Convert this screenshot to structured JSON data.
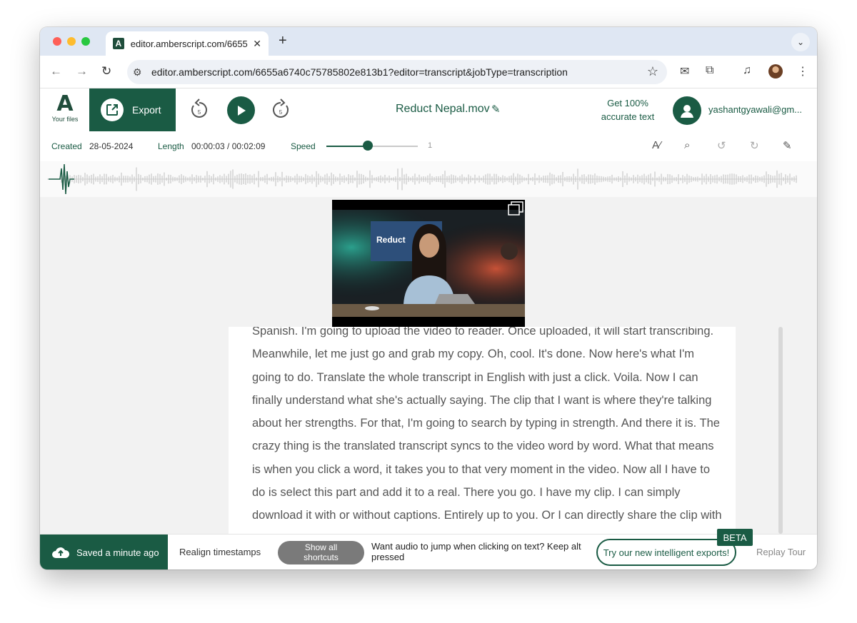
{
  "browser": {
    "tab_title": "editor.amberscript.com/6655",
    "url": "editor.amberscript.com/6655a6740c75785802e813b1?editor=transcript&jobType=transcription"
  },
  "header": {
    "logo_letter": "A",
    "logo_label": "Your files",
    "export_label": "Export",
    "skip_back_label": "5",
    "skip_forward_label": "5",
    "file_name": "Reduct Nepal.mov",
    "accurate_text_line1": "Get 100%",
    "accurate_text_line2": "accurate text",
    "user_email": "yashantgyawali@gm..."
  },
  "info": {
    "created_label": "Created",
    "created_value": "28-05-2024",
    "length_label": "Length",
    "length_value": "00:00:03 / 00:02:09",
    "speed_label": "Speed",
    "speed_value": "1",
    "speed_fraction": 0.45
  },
  "transcript": {
    "text": "Spanish. I'm going to upload the video to reader. Once uploaded, it will start transcribing. Meanwhile, let me just go and grab my copy. Oh, cool. It's done. Now here's what I'm going to do. Translate the whole transcript in English with just a click. Voila. Now I can finally understand what she's actually saying. The clip that I want is where they're talking about her strengths. For that, I'm going to search by typing in strength. And there it is. The crazy thing is the translated transcript syncs to the video word by word. What that means is when you click a word, it takes you to that very moment in the video. Now all I have to do is select this part and add it to a real. There you go. I have my clip. I can simply download it with or without captions. Entirely up to you. Or I can directly share the clip with my team."
  },
  "video": {
    "screen_text": "Reduct"
  },
  "bottom": {
    "saved_label": "Saved a minute ago",
    "realign_label": "Realign timestamps",
    "shortcuts_line1": "Show all",
    "shortcuts_line2": "shortcuts",
    "hint_text": "Want audio to jump when clicking on text? Keep alt pressed",
    "intelligent_exports_label": "Try our new intelligent exports!",
    "beta_label": "BETA",
    "replay_tour_label": "Replay Tour"
  },
  "colors": {
    "brand_green": "#1a5b44",
    "tab_strip": "#dfe7f3"
  }
}
